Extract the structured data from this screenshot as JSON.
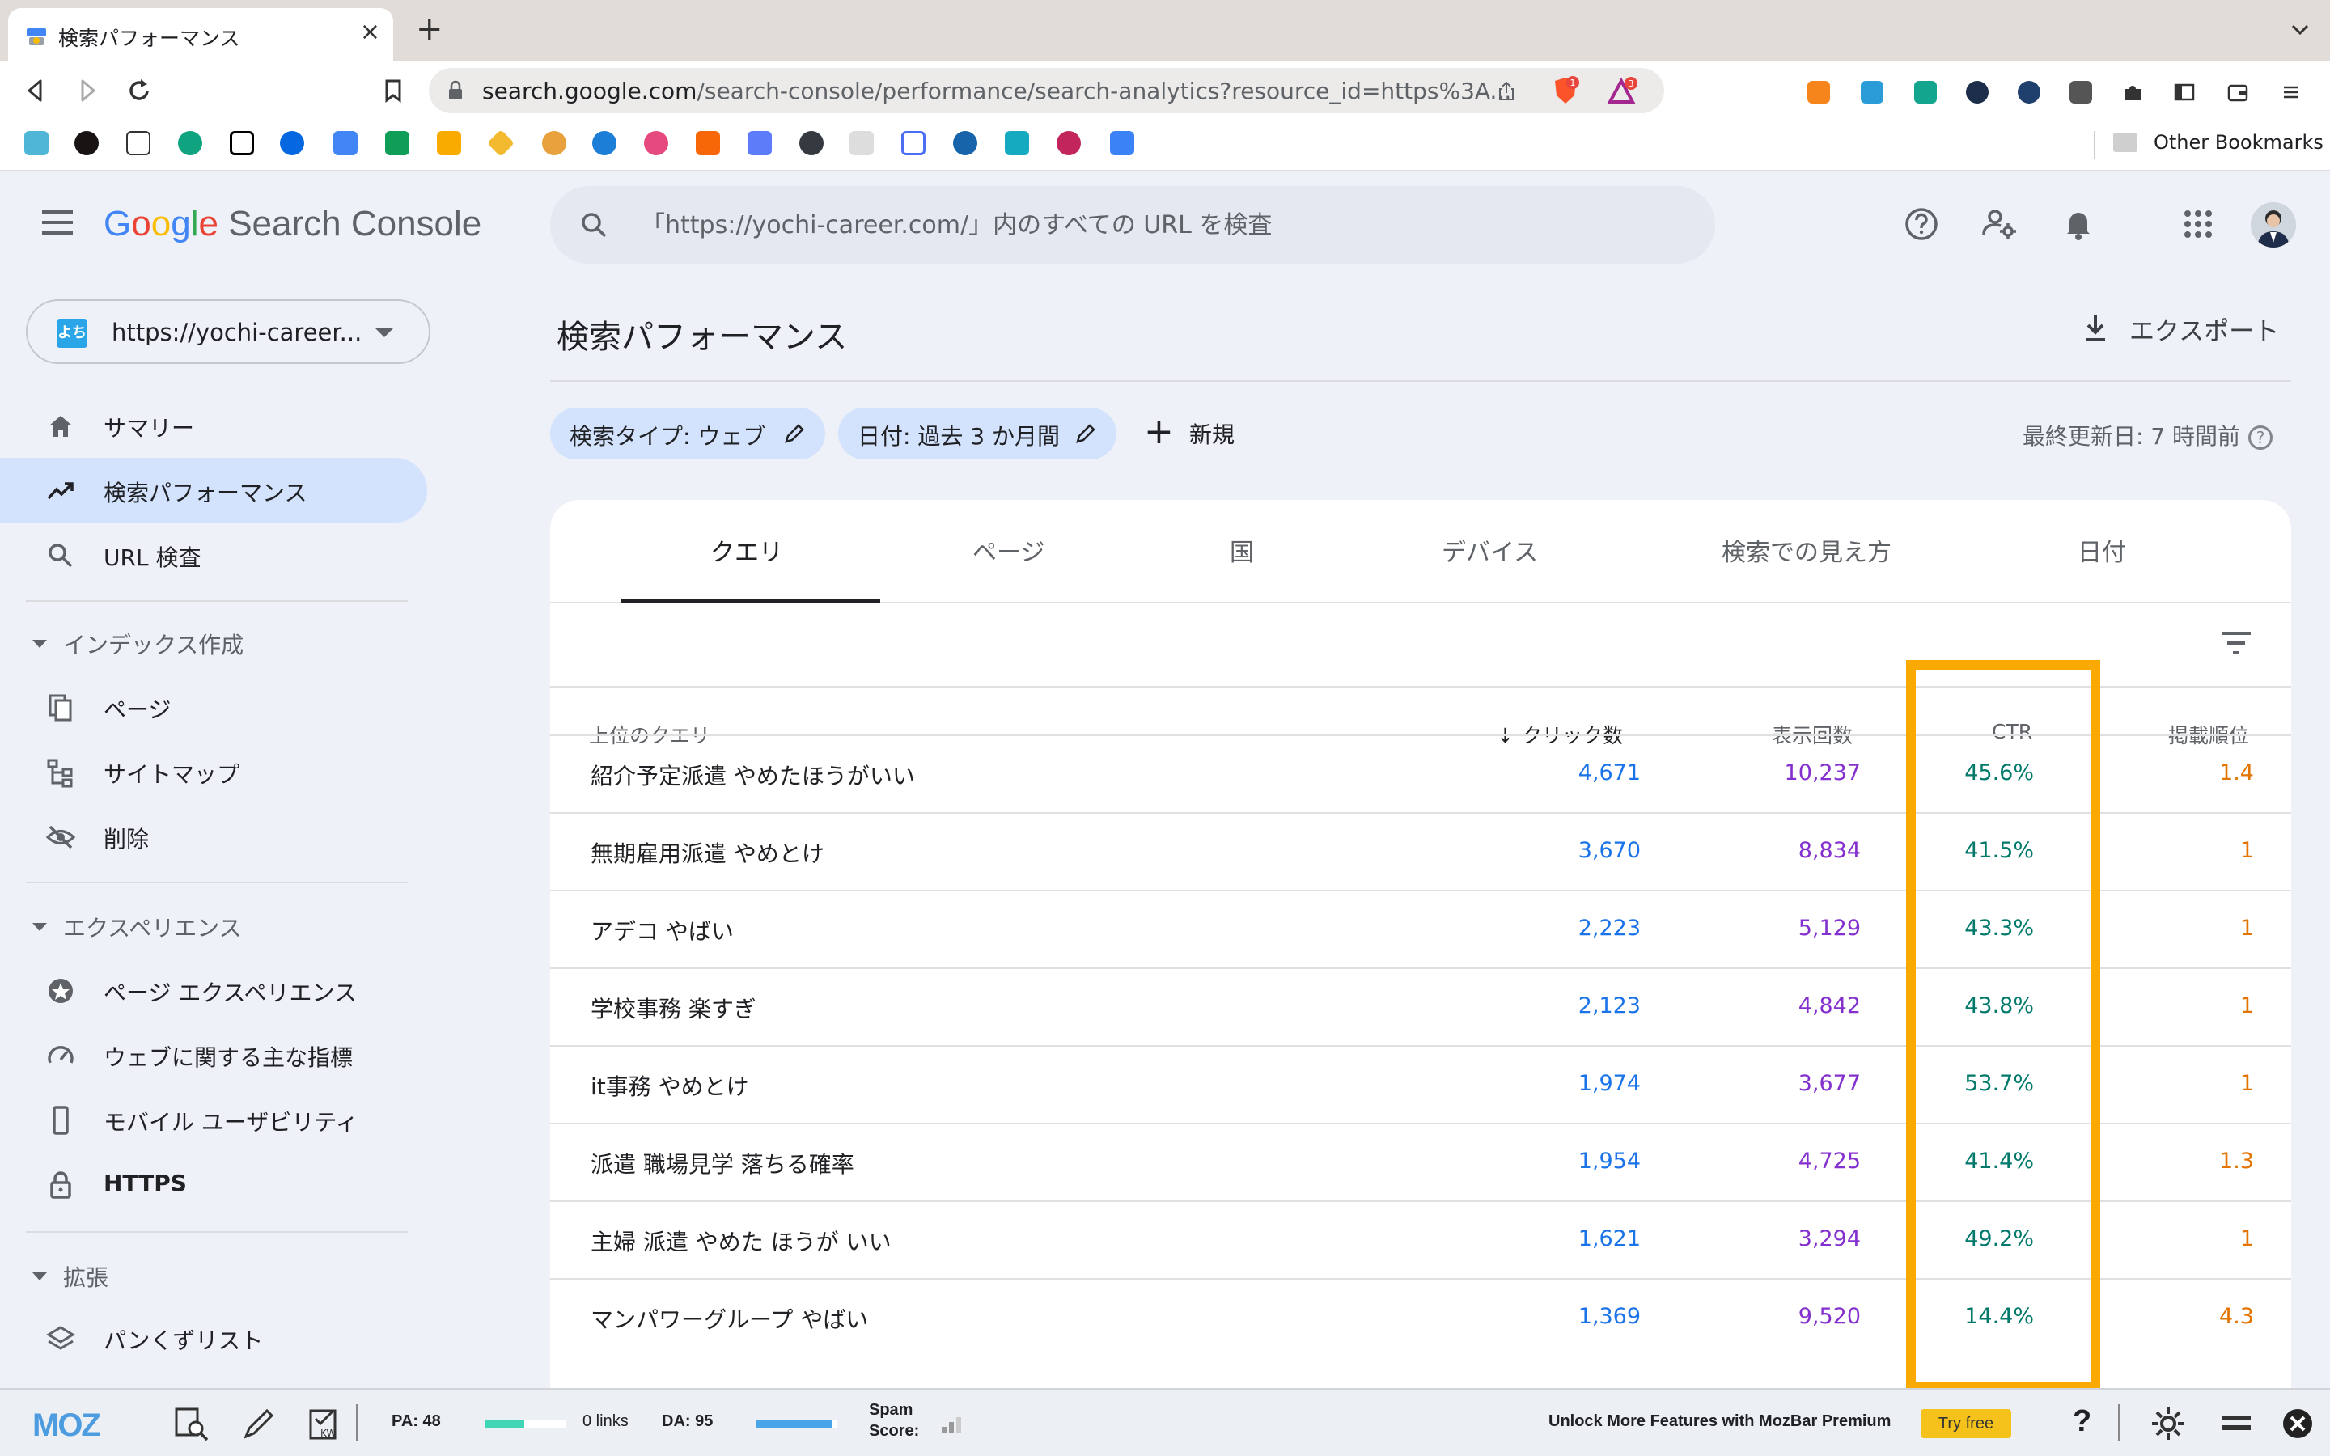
{
  "browser": {
    "tab_title": "検索パフォーマンス",
    "url_host": "search.google.com",
    "url_path": "/search-console/performance/search-analytics?resource_id=https%3A...",
    "brave_badge": "1",
    "reward_badge": "3",
    "other_bookmarks": "Other Bookmarks"
  },
  "app": {
    "logo_google": "Google",
    "logo_product": "Search Console",
    "search_placeholder": "「https://yochi-career.com/」内のすべての URL を検査"
  },
  "sidebar": {
    "property": "https://yochi-career...",
    "property_icon_text": "よち",
    "items": [
      {
        "label": "サマリー",
        "icon": "home-icon"
      },
      {
        "label": "検索パフォーマンス",
        "icon": "trending-up-icon",
        "active": true
      },
      {
        "label": "URL 検査",
        "icon": "search-icon"
      }
    ],
    "section_index": "インデックス作成",
    "index_items": [
      {
        "label": "ページ",
        "icon": "pages-icon"
      },
      {
        "label": "サイトマップ",
        "icon": "sitemap-icon"
      },
      {
        "label": "削除",
        "icon": "removal-icon"
      }
    ],
    "section_experience": "エクスペリエンス",
    "experience_items": [
      {
        "label": "ページ エクスペリエンス",
        "icon": "page-experience-icon"
      },
      {
        "label": "ウェブに関する主な指標",
        "icon": "speedometer-icon"
      },
      {
        "label": "モバイル ユーザビリティ",
        "icon": "phone-icon"
      },
      {
        "label": "HTTPS",
        "icon": "lock-icon"
      }
    ],
    "section_enhancements": "拡張",
    "enhancement_items": [
      {
        "label": "パンくずリスト",
        "icon": "layers-icon"
      }
    ]
  },
  "main": {
    "title": "検索パフォーマンス",
    "export_label": "エクスポート",
    "chips": [
      {
        "label": "検索タイプ: ウェブ"
      },
      {
        "label": "日付: 過去 3 か月間"
      }
    ],
    "new_label": "新規",
    "last_updated": "最終更新日: 7 時間前",
    "tabs": [
      "クエリ",
      "ページ",
      "国",
      "デバイス",
      "検索での見え方",
      "日付"
    ],
    "active_tab": "クエリ",
    "table": {
      "headers": {
        "query": "上位のクエリ",
        "clicks": "クリック数",
        "impressions": "表示回数",
        "ctr": "CTR",
        "position": "掲載順位"
      },
      "rows": [
        {
          "query": "紹介予定派遣 やめたほうがいい",
          "clicks": "4,671",
          "impressions": "10,237",
          "ctr": "45.6%",
          "position": "1.4"
        },
        {
          "query": "無期雇用派遣 やめとけ",
          "clicks": "3,670",
          "impressions": "8,834",
          "ctr": "41.5%",
          "position": "1"
        },
        {
          "query": "アデコ やばい",
          "clicks": "2,223",
          "impressions": "5,129",
          "ctr": "43.3%",
          "position": "1"
        },
        {
          "query": "学校事務 楽すぎ",
          "clicks": "2,123",
          "impressions": "4,842",
          "ctr": "43.8%",
          "position": "1"
        },
        {
          "query": "it事務 やめとけ",
          "clicks": "1,974",
          "impressions": "3,677",
          "ctr": "53.7%",
          "position": "1"
        },
        {
          "query": "派遣 職場見学 落ちる確率",
          "clicks": "1,954",
          "impressions": "4,725",
          "ctr": "41.4%",
          "position": "1.3"
        },
        {
          "query": "主婦 派遣 やめた ほうが いい",
          "clicks": "1,621",
          "impressions": "3,294",
          "ctr": "49.2%",
          "position": "1"
        },
        {
          "query": "マンパワーグループ やばい",
          "clicks": "1,369",
          "impressions": "9,520",
          "ctr": "14.4%",
          "position": "4.3"
        }
      ]
    }
  },
  "mozbar": {
    "logo": "MOZ",
    "pa": "PA: 48",
    "pa_fill": 0.48,
    "links": "0 links",
    "da": "DA: 95",
    "da_fill": 0.95,
    "spam_label": "Spam",
    "spam_label2": "Score:",
    "promo": "Unlock More Features with MozBar Premium",
    "try_free": "Try free",
    "help": "?"
  },
  "colors": {
    "accent_blue": "#1a73e8",
    "impressions_purple": "#8430ce",
    "ctr_teal": "#00796b",
    "position_orange": "#e37400",
    "highlight_orange": "#f9a900",
    "nav_active": "#d3e3fd"
  }
}
